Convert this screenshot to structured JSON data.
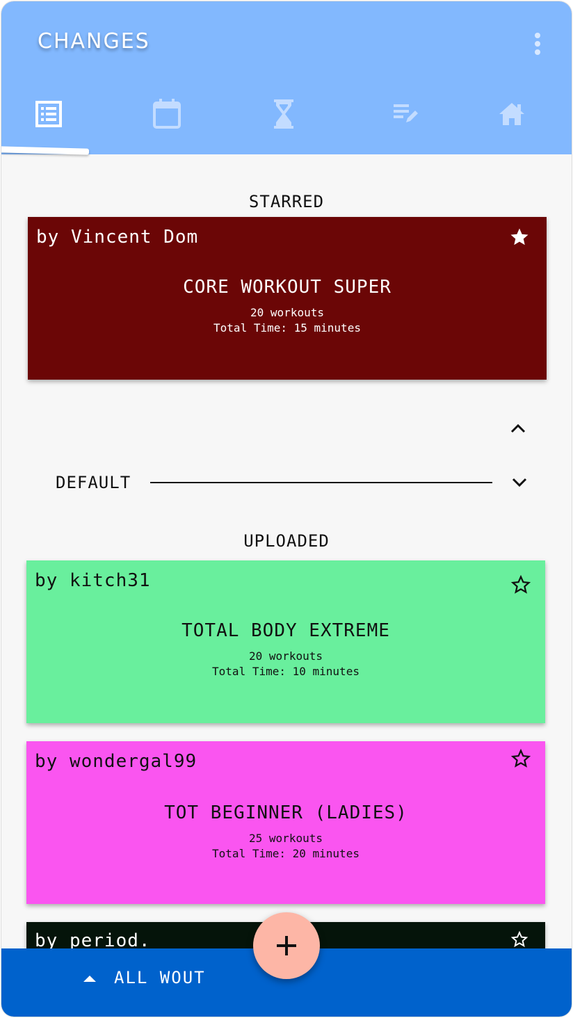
{
  "app": {
    "title": "CHANGES"
  },
  "tabs": [
    {
      "name": "list-icon",
      "selected": true
    },
    {
      "name": "calendar-icon",
      "selected": false
    },
    {
      "name": "hourglass-icon",
      "selected": false
    },
    {
      "name": "edit-notes-icon",
      "selected": false
    },
    {
      "name": "home-icon",
      "selected": false
    }
  ],
  "sections": {
    "starred": "STARRED",
    "default": "DEFAULT",
    "uploaded": "UPLOADED"
  },
  "cards": [
    {
      "author": "by Vincent Dom",
      "title": "CORE WORKOUT SUPER",
      "workouts": "20 workouts",
      "total_time": "Total Time: 15 minutes",
      "starred": true,
      "color": "#6b0606",
      "text_color": "#ffffff"
    },
    {
      "author": "by kitch31",
      "title": "TOTAL BODY EXTREME",
      "workouts": "20 workouts",
      "total_time": "Total Time: 10 minutes",
      "starred": false,
      "color": "#69ef9d",
      "text_color": "#111111"
    },
    {
      "author": "by wondergal99",
      "title": "TOT BEGINNER (LADIES)",
      "workouts": "25 workouts",
      "total_time": "Total Time: 20 minutes",
      "starred": false,
      "color": "#fa55f0",
      "text_color": "#111111"
    },
    {
      "author": "by period.",
      "color": "#05140a",
      "text_color": "#ffffff"
    }
  ],
  "bottom_bar": {
    "label": "ALL WOUT"
  },
  "colors": {
    "appbar": "#82b8fe",
    "bottombar": "#0062cc",
    "fab": "#fdb6a6"
  }
}
